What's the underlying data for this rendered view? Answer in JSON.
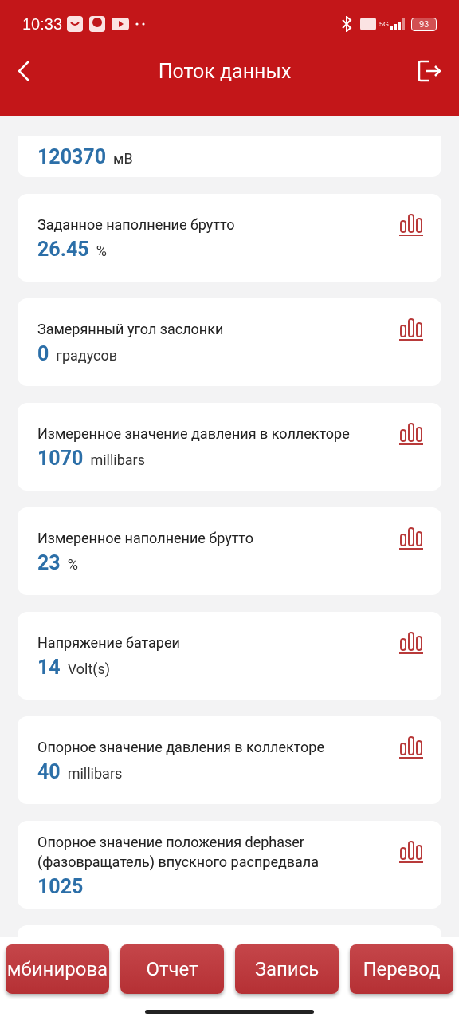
{
  "status_bar": {
    "time": "10:33",
    "network": "5G",
    "battery": "93"
  },
  "header": {
    "title": "Поток данных"
  },
  "items": [
    {
      "kind": "partial",
      "value": "120370",
      "unit": "мВ"
    },
    {
      "kind": "full",
      "name": "Заданное наполнение брутто",
      "value": "26.45",
      "unit": "%"
    },
    {
      "kind": "full",
      "name": "Замерянный угол заслонки",
      "value": "0",
      "unit": "градусов"
    },
    {
      "kind": "full",
      "name": "Измеренное значение давления в коллекторе",
      "value": "1070",
      "unit": "millibars"
    },
    {
      "kind": "full",
      "name": "Измеренное наполнение брутто",
      "value": "23",
      "unit": "%"
    },
    {
      "kind": "full",
      "name": "Напряжение батареи",
      "value": "14",
      "unit": "Volt(s)"
    },
    {
      "kind": "full",
      "name": "Опорное значение давления в коллекторе",
      "value": "40",
      "unit": "millibars"
    },
    {
      "kind": "full",
      "name": "Опорное значение положения dephaser (фазовращатель) впускного распредвала",
      "value": "1025"
    },
    {
      "kind": "stub"
    }
  ],
  "buttons": [
    "мбинирова",
    "Отчет",
    "Запись",
    "Перевод"
  ]
}
